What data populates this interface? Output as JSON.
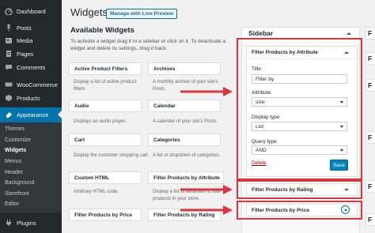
{
  "admin_menu": {
    "items": [
      {
        "label": "Dashboard",
        "icon": "dashboard-icon"
      },
      {
        "label": "Posts",
        "icon": "pin-icon"
      },
      {
        "label": "Media",
        "icon": "media-icon"
      },
      {
        "label": "Pages",
        "icon": "pages-icon"
      },
      {
        "label": "Comments",
        "icon": "comments-icon"
      },
      {
        "label": "WooCommerce",
        "icon": "woocommerce-icon"
      },
      {
        "label": "Products",
        "icon": "products-icon"
      },
      {
        "label": "Appearance",
        "icon": "appearance-icon"
      },
      {
        "label": "Plugins",
        "icon": "plugins-icon"
      }
    ],
    "submenu": [
      "Themes",
      "Customize",
      "Widgets",
      "Menus",
      "Header",
      "Background",
      "Storefront",
      "Editor"
    ]
  },
  "header": {
    "title": "Widgets",
    "preview_button": "Manage with Live Preview"
  },
  "available": {
    "title": "Available Widgets",
    "intro": "To activate a widget drag it to a sidebar or click on it. To deactivate a widget and delete its settings, drag it back.",
    "widgets": [
      {
        "title": "Active Product Filters",
        "desc": "Display a list of active product filters."
      },
      {
        "title": "Archives",
        "desc": "A monthly archive of your site's Posts."
      },
      {
        "title": "Audio",
        "desc": "Displays an audio player."
      },
      {
        "title": "Calendar",
        "desc": "A calendar of your site's Posts."
      },
      {
        "title": "Cart",
        "desc": "Display the customer shopping cart."
      },
      {
        "title": "Categories",
        "desc": "A list or dropdown of categories."
      },
      {
        "title": "Custom HTML",
        "desc": "Arbitrary HTML code."
      },
      {
        "title": "Filter Products by Attribute",
        "desc": "Display a list of attributes to filter products in your store."
      },
      {
        "title": "Filter Products by Price",
        "desc": ""
      },
      {
        "title": "Filter Products by Rating",
        "desc": ""
      }
    ]
  },
  "sidebar": {
    "title": "Sidebar",
    "open_widget": {
      "title": "Filter Products by Attribute",
      "title_label": "Title",
      "title_value": "Filter by",
      "attribute_label": "Attribute",
      "attribute_value": "size",
      "display_label": "Display type",
      "display_value": "List",
      "query_label": "Query type",
      "query_value": "AND",
      "delete_label": "Delete",
      "save_label": "Save"
    },
    "rows": [
      "Filter Products by Rating",
      "Filter Products by Price"
    ]
  },
  "edge_panels": [
    "F",
    "F",
    "F",
    "F",
    "F",
    "F"
  ],
  "colors": {
    "admin_bg": "#23282d",
    "active_blue": "#0073aa",
    "highlight_red": "#d9363e"
  }
}
